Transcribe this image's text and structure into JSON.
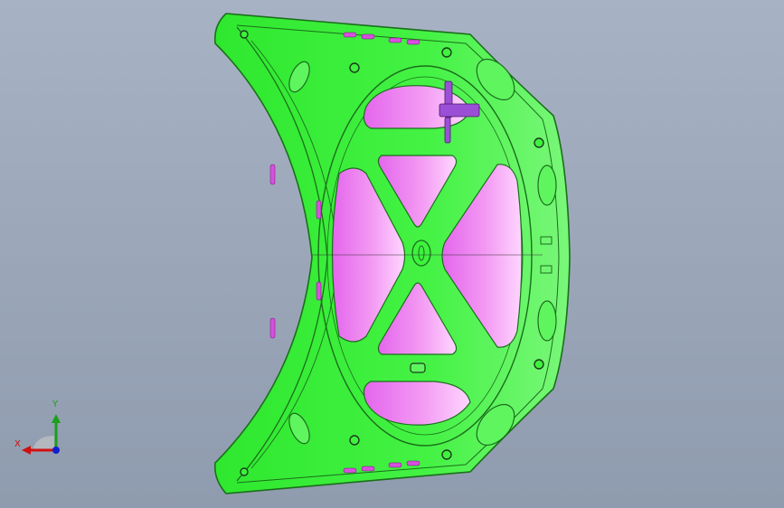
{
  "viewport": {
    "background_top": "#a7b3c4",
    "background_bottom": "#8f9bae"
  },
  "model": {
    "panel_color": "#3ef23e",
    "panel_edge_color": "#1b6e1b",
    "cutout_color": "#f07af0",
    "cutout_light_color": "#ffc8ff",
    "bracket_color": "#9b4fd6"
  },
  "triad": {
    "x_label": "X",
    "y_label": "Y",
    "x_color": "#d01010",
    "y_color": "#1aa01a",
    "z_color": "#1020d0"
  }
}
